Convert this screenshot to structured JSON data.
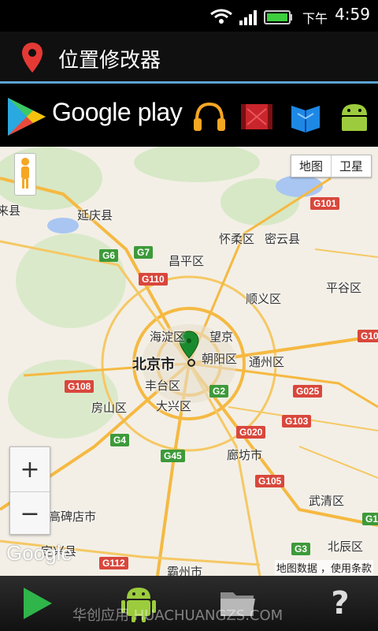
{
  "status_bar": {
    "ampm": "下午",
    "time": "4:59"
  },
  "title_bar": {
    "title": "位置修改器"
  },
  "banner": {
    "store_name": "Google play",
    "icons": [
      "play-store-icon",
      "headphones-icon",
      "movie-icon",
      "books-icon",
      "android-icon"
    ]
  },
  "map": {
    "map_type_buttons": [
      "地图",
      "卫星"
    ],
    "zoom_in": "+",
    "zoom_out": "−",
    "labels": {
      "yanqing": "延庆县",
      "laixi": "来县",
      "huairou": "怀柔区",
      "miyun": "密云县",
      "changping": "昌平区",
      "pinggu": "平谷区",
      "shunyi": "顺义区",
      "haidian": "海淀区",
      "wangjing": "望京",
      "beijing": "北京市",
      "chaoyang": "朝阳区",
      "tongzhou": "通州区",
      "fengtai": "丰台区",
      "fangshan": "房山区",
      "daxing": "大兴区",
      "langfang": "廊坊市",
      "gaobeidian": "高碑店市",
      "wuqing": "武清区",
      "beichen": "北辰区",
      "dingxing": "定兴县",
      "bazhou": "霸州市"
    },
    "shields": {
      "g101": "G101",
      "g6": "G6",
      "g7": "G7",
      "g110": "G110",
      "g108": "G108",
      "g2": "G2",
      "g025": "G025",
      "g103": "G103",
      "g020": "G020",
      "g4": "G4",
      "g45": "G45",
      "g105": "G105",
      "g1": "G1",
      "g3": "G3",
      "g112": "G112",
      "g10": "G10"
    },
    "logo": "Google",
    "attribution": "地图数据 ，使用条款"
  },
  "bottom_bar": {
    "watermark": "华创应用 HUACHUANGZS.COM",
    "help": "?"
  },
  "colors": {
    "title_accent": "#5aa2d0",
    "pin_red": "#e53935",
    "marker_green": "#1a8a2e",
    "play_green": "#2fb54a"
  }
}
